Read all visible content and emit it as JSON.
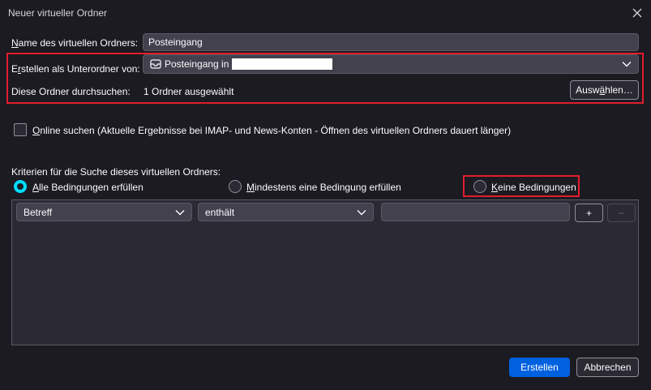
{
  "window": {
    "title": "Neuer virtueller Ordner",
    "close_icon": "close-icon"
  },
  "form": {
    "name_label_accel": "N",
    "name_label_rest": "ame des virtuellen Ordners:",
    "name_value": "Posteingang",
    "parent_label_pre": "E",
    "parent_label_accel": "r",
    "parent_label_rest": "stellen als Unterordner von:",
    "parent_value": "Posteingang in",
    "parent_icon": "inbox-icon",
    "search_folders_label": "Diese Ordner durchsuchen:",
    "search_folders_value": "1 Ordner ausgewählt",
    "choose_button_pre": "Ausw",
    "choose_button_accel": "ä",
    "choose_button_rest": "hlen…",
    "online_accel": "O",
    "online_rest": "nline suchen (Aktuelle Ergebnisse bei IMAP- und News-Konten - Öffnen des virtuellen Ordners dauert länger)",
    "criteria_label": "Kriterien für die Suche dieses virtuellen Ordners:"
  },
  "match": {
    "all_accel": "A",
    "all_rest": "lle Bedingungen erfüllen",
    "any_accel": "M",
    "any_rest": "indestens eine Bedingung erfüllen",
    "none_accel": "K",
    "none_rest": "eine Bedingungen",
    "selected": "all"
  },
  "rule": {
    "field": "Betreff",
    "operator": "enthält",
    "value": "",
    "add_label": "+",
    "remove_label": "−"
  },
  "footer": {
    "create_label": "Erstellen",
    "cancel_label": "Abbrechen"
  },
  "colors": {
    "accent": "#0061e0",
    "highlight_box": "#e11d2e",
    "radio_checked": "#00ddff"
  }
}
